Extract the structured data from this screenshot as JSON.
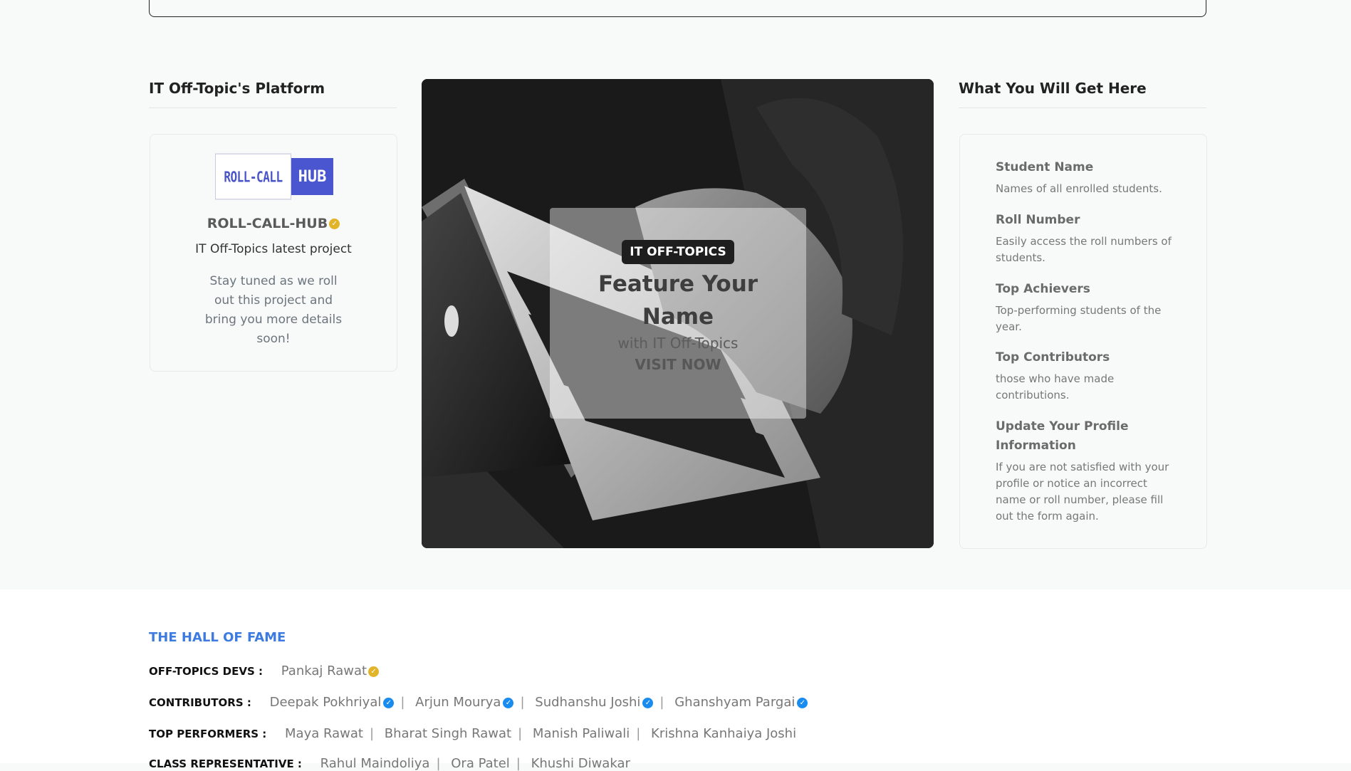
{
  "platform": {
    "heading": "IT Off-Topic's Platform",
    "logo": {
      "left": "ROLL-CALL",
      "right": "HUB"
    },
    "project_name": "ROLL-CALL-HUB",
    "project_subtitle": "IT Off-Topics latest project",
    "project_description": "Stay tuned as we roll out this project and bring you more details soon!"
  },
  "hero": {
    "tag": "IT OFF-TOPICS",
    "title": "Feature Your Name",
    "subtitle": "with IT Off-Topics",
    "link": "VISIT NOW"
  },
  "benefits": {
    "heading": "What You Will Get Here",
    "items": [
      {
        "title": "Student Name",
        "desc": "Names of all enrolled students."
      },
      {
        "title": "Roll Number",
        "desc": "Easily access the roll numbers of students."
      },
      {
        "title": "Top Achievers",
        "desc": "Top-performing students of the year."
      },
      {
        "title": "Top Contributors",
        "desc": "those who have made contributions."
      },
      {
        "title": "Update Your Profile Information",
        "desc": "If you are not satisfied with your profile or notice an incorrect name or roll number, please fill out the form again."
      }
    ]
  },
  "hall_of_fame": {
    "title": "THE HALL OF FAME",
    "devs": {
      "label": "OFF-TOPICS DEVS :",
      "names": [
        "Pankaj Rawat"
      ]
    },
    "contributors": {
      "label": "CONTRIBUTORS :",
      "names": [
        "Deepak Pokhriyal",
        "Arjun Mourya",
        "Sudhanshu Joshi",
        "Ghanshyam Pargai"
      ]
    },
    "top_performers": {
      "label": "TOP PERFORMERS :",
      "names": [
        "Maya Rawat",
        "Bharat Singh Rawat",
        "Manish Paliwali",
        "Krishna Kanhaiya Joshi"
      ]
    },
    "class_reps": {
      "label": "CLASS REPRESENTATIVE :",
      "names": [
        "Rahul Maindoliya",
        "Ora Patel",
        "Khushi Diwakar"
      ]
    }
  },
  "colors": {
    "accent": "#3d7be0",
    "verified_gold": "#e2b42a",
    "verified_blue": "#1a8cf0"
  }
}
